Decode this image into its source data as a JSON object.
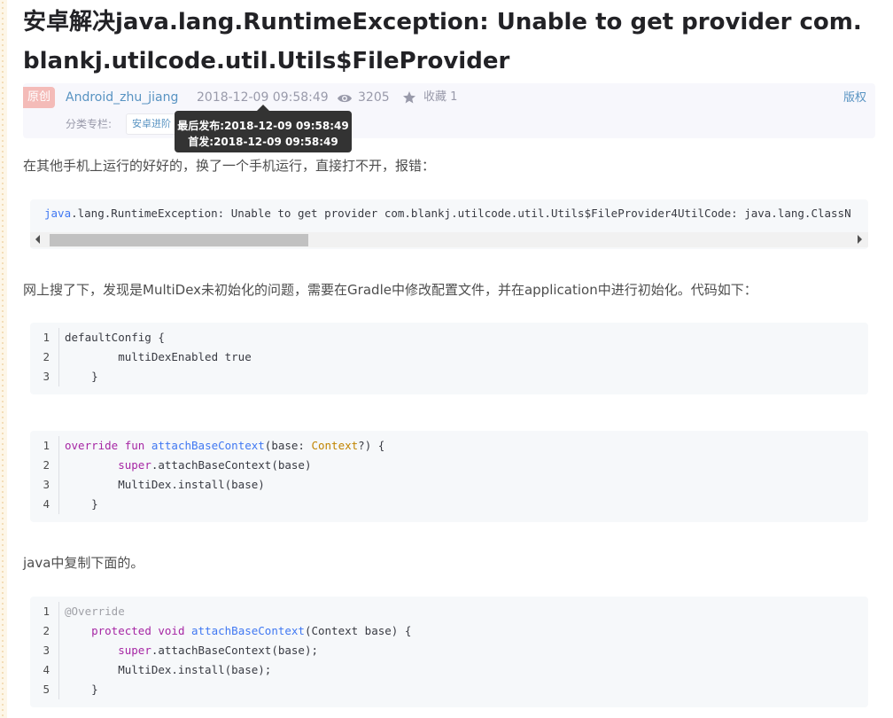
{
  "article": {
    "title": "安卓解决java.lang.RuntimeException: Unable to get provider com.blankj.utilcode.util.Utils$FileProvider",
    "meta": {
      "badge": "原创",
      "author": "Android_zhu_jiang",
      "time": "2018-12-09 09:58:49",
      "views": "3205",
      "favorites": "收藏 1",
      "copyright": "版权",
      "category_label": "分类专栏:",
      "category_tag": "安卓进阶"
    },
    "tooltip": {
      "line1": "最后发布:2018-12-09 09:58:49",
      "line2": "首发:2018-12-09 09:58:49"
    },
    "paragraphs": {
      "p1": "在其他手机上运行的好好的，换了一个手机运行，直接打不开，报错：",
      "p2": "网上搜了下，发现是MultiDex未初始化的问题，需要在Gradle中修改配置文件，并在application中进行初始化。代码如下：",
      "p3": "java中复制下面的。"
    },
    "error_code": {
      "prefix": "java",
      "rest": ".lang.RuntimeException: Unable to get provider com.blankj.utilcode.util.Utils$FileProvider4UtilCode: java.lang.ClassN"
    },
    "code_gradle": {
      "line_numbers": [
        "1",
        "2",
        "3"
      ],
      "lines": [
        "defaultConfig {",
        "        multiDexEnabled true",
        "    }"
      ]
    },
    "code_kotlin": {
      "line_numbers": [
        "1",
        "2",
        "3",
        "4"
      ],
      "l1_kw1": "override",
      "l1_kw2": "fun",
      "l1_fn": "attachBaseContext",
      "l1_param": "(base: ",
      "l1_type": "Context",
      "l1_end": "?) {",
      "l2_kw": "super",
      "l2_rest": ".attachBaseContext(base)",
      "l3": "        MultiDex.install(base)",
      "l4": "    }"
    },
    "code_java": {
      "line_numbers": [
        "1",
        "2",
        "3",
        "4",
        "5"
      ],
      "l1_annotation": "@Override",
      "l2_kw1": "protected",
      "l2_kw2": "void",
      "l2_fn": "attachBaseContext",
      "l2_rest": "(Context base) {",
      "l3_kw": "super",
      "l3_rest": ".attachBaseContext(base);",
      "l4": "        MultiDex.install(base);",
      "l5": "    }"
    }
  }
}
